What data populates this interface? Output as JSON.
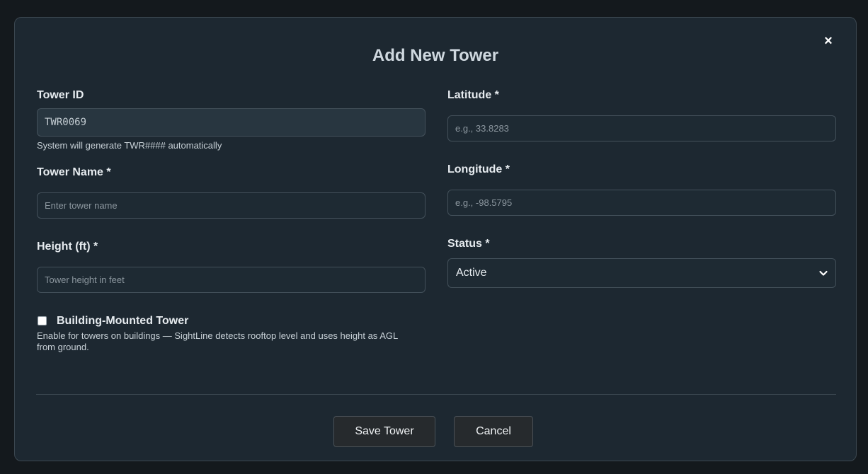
{
  "dialog": {
    "title": "Add New Tower",
    "close_label": "×"
  },
  "fields": {
    "tower_id": {
      "label": "Tower ID",
      "value": "TWR0069",
      "hint": "System will generate TWR#### automatically"
    },
    "tower_name": {
      "label": "Tower Name *",
      "placeholder": "Enter tower name"
    },
    "height": {
      "label": "Height (ft) *",
      "placeholder": "Tower height in feet"
    },
    "latitude": {
      "label": "Latitude *",
      "placeholder": "e.g., 33.8283"
    },
    "longitude": {
      "label": "Longitude *",
      "placeholder": "e.g., -98.5795"
    },
    "status": {
      "label": "Status *",
      "selected": "Active"
    },
    "building_mounted": {
      "label": "Building-Mounted Tower",
      "hint_line1": "Enable for towers on buildings — SightLine detects rooftop level and uses height as AGL",
      "hint_line2": "from ground.",
      "checked": false
    }
  },
  "actions": {
    "save_label": "Save Tower",
    "cancel_label": "Cancel"
  },
  "icons": {
    "close": "close-icon",
    "status_dropdown": "chevron-down-icon"
  },
  "colors": {
    "modal_background": "#1d2831",
    "input_border": "#43505a",
    "text_primary": "#e6ebef",
    "title": "#cfd8df"
  }
}
